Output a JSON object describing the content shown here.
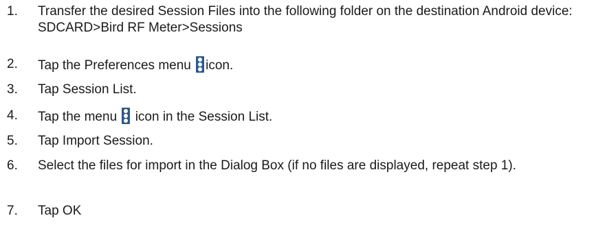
{
  "steps": [
    {
      "number": "1.",
      "text": "Transfer the desired Session Files into the following folder on the destination Android device: SDCARD>Bird RF Meter>Sessions"
    },
    {
      "number": "2.",
      "text_before": "Tap the Preferences menu",
      "icon": "vertical-ellipsis-menu-icon",
      "text_after": "icon."
    },
    {
      "number": "3.",
      "text": "Tap Session List."
    },
    {
      "number": "4.",
      "text_before": "Tap the menu",
      "icon": "vertical-ellipsis-menu-icon",
      "text_after": "icon in the Session List."
    },
    {
      "number": "5.",
      "text": "Tap Import Session."
    },
    {
      "number": "6.",
      "text": "Select the files for import in the Dialog Box (if no files are displayed, repeat step 1)."
    },
    {
      "number": "7.",
      "text": "Tap OK"
    }
  ],
  "colors": {
    "text": "#1a1a1a",
    "icon_background": "#2b5a8c",
    "icon_dots": "#ffffff"
  }
}
